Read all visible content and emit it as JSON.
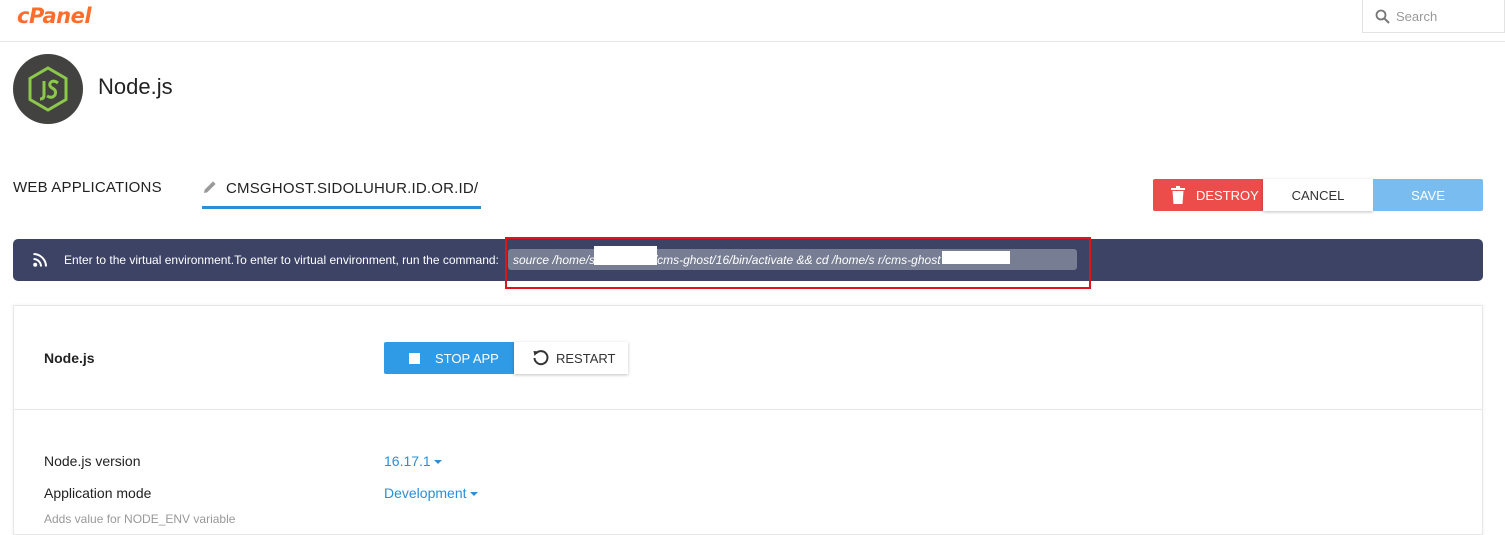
{
  "header": {
    "logo": "cPanel",
    "search_placeholder": "Search"
  },
  "app": {
    "title": "Node.js"
  },
  "tabs": {
    "web_applications": "WEB APPLICATIONS",
    "domain": "CMSGHOST.SIDOLUHUR.ID.OR.ID/"
  },
  "actions": {
    "destroy": "DESTROY",
    "cancel": "CANCEL",
    "save": "SAVE"
  },
  "banner": {
    "message": "Enter to the virtual environment.To enter to virtual environment, run the command:",
    "command": "source /home/s          /nodevenv/cms-ghost/16/bin/activate && cd /home/s             r/cms-ghost"
  },
  "panel": {
    "heading": "Node.js",
    "stop_app": "STOP APP",
    "restart": "RESTART",
    "fields": [
      {
        "label": "Node.js version",
        "value": "16.17.1"
      },
      {
        "label": "Application mode",
        "value": "Development"
      }
    ],
    "help": "Adds value for NODE_ENV variable"
  },
  "colors": {
    "brand": "#ff6c2c",
    "accent": "#2a8fd6",
    "danger": "#ec4c4a",
    "banner_bg": "#3c4365",
    "highlight": "#e0141a"
  }
}
